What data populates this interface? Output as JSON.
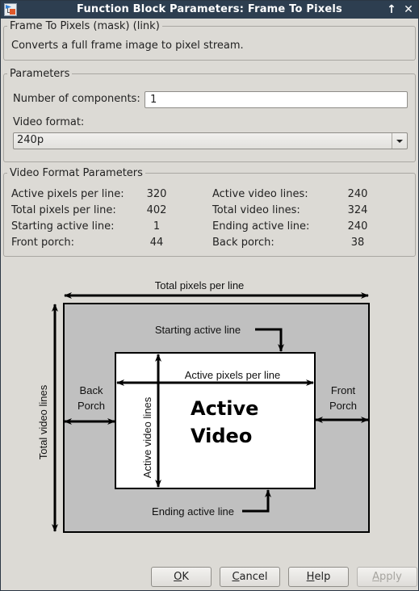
{
  "window": {
    "title": "Function Block Parameters: Frame To Pixels",
    "icon": "simulink-block-icon",
    "controls": {
      "maximize": "↑",
      "close": "✕"
    }
  },
  "description_group": {
    "legend": "Frame To Pixels (mask) (link)",
    "text": "Converts a full frame image to pixel stream."
  },
  "parameters": {
    "legend": "Parameters",
    "num_components_label": "Number of components:",
    "num_components_value": "1",
    "video_format_label": "Video format:",
    "video_format_value": "240p"
  },
  "video_format_parameters": {
    "legend": "Video Format Parameters",
    "left": [
      {
        "label": "Active pixels per line:",
        "value": "320"
      },
      {
        "label": "Total pixels per line:",
        "value": "402"
      },
      {
        "label": "Starting active line:",
        "value": "1"
      },
      {
        "label": "Front porch:",
        "value": "44"
      }
    ],
    "right": [
      {
        "label": "Active video lines:",
        "value": "240"
      },
      {
        "label": "Total video lines:",
        "value": "324"
      },
      {
        "label": "Ending active line:",
        "value": "240"
      },
      {
        "label": "Back porch:",
        "value": "38"
      }
    ]
  },
  "diagram": {
    "total_pixels_per_line": "Total pixels per line",
    "starting_active_line": "Starting active line",
    "active_pixels_per_line": "Active pixels per line",
    "back_porch_1": "Back",
    "back_porch_2": "Porch",
    "front_porch_1": "Front",
    "front_porch_2": "Porch",
    "active_video_1": "Active",
    "active_video_2": "Video",
    "active_video_lines": "Active video lines",
    "total_video_lines": "Total video lines",
    "ending_active_line": "Ending active line",
    "colors": {
      "blanking": "#c0c0c0",
      "active": "#ffffff",
      "stroke": "#000000"
    }
  },
  "buttons": {
    "ok": {
      "mnemonic": "O",
      "rest": "K"
    },
    "cancel": {
      "mnemonic": "C",
      "rest": "ancel"
    },
    "help": {
      "mnemonic": "H",
      "rest": "elp"
    },
    "apply": {
      "mnemonic": "A",
      "rest": "pply",
      "disabled": true
    }
  }
}
